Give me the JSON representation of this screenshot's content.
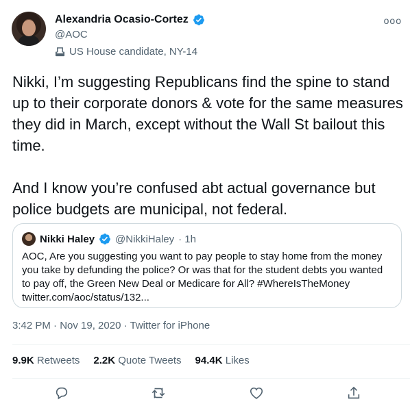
{
  "author": {
    "name": "Alexandria Ocasio-Cortez",
    "handle": "@AOC",
    "label": "US House candidate, NY-14"
  },
  "tweet_text": "Nikki, I’m suggesting Republicans find the spine to stand up to their corporate donors & vote for the same measures they did in March, except without the Wall St bailout this time.\n\nAnd I know you’re confused abt actual governance but police budgets are municipal, not federal.",
  "quoted": {
    "name": "Nikki Haley",
    "handle": "@NikkiHaley",
    "time": "· 1h",
    "text": "AOC, Are you suggesting you want to pay people to stay home from the money you take by defunding the police? Or was that for the student debts you wanted to pay off, the Green New Deal or Medicare for All? #WhereIsTheMoney twitter.com/aoc/status/132..."
  },
  "meta": "3:42 PM · Nov 19, 2020 · Twitter for iPhone",
  "stats": {
    "retweets_count": "9.9K",
    "retweets_label": "Retweets",
    "quotes_count": "2.2K",
    "quotes_label": "Quote Tweets",
    "likes_count": "94.4K",
    "likes_label": "Likes"
  },
  "more_label": "ooo",
  "colors": {
    "verified": "#1d9bf0",
    "secondary_text": "#536471",
    "border": "#cfd9de"
  },
  "icons": [
    "reply-icon",
    "retweet-icon",
    "like-icon",
    "share-icon"
  ]
}
